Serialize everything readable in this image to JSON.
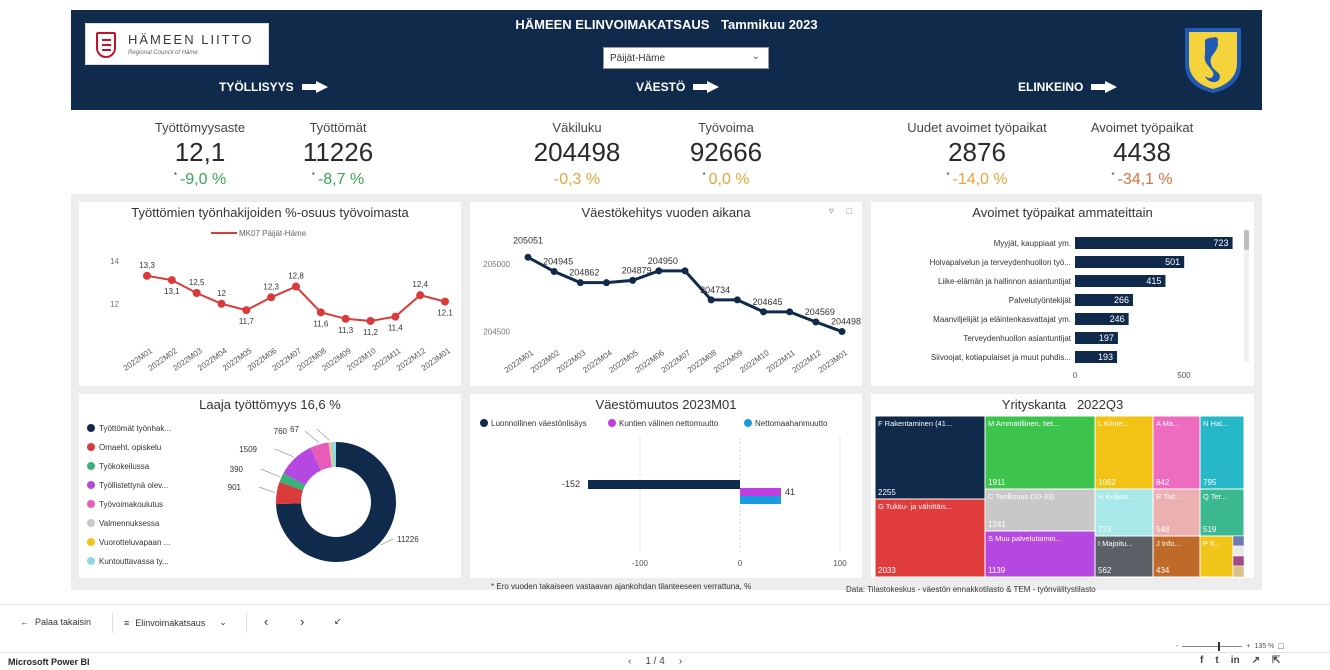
{
  "header": {
    "logo_title": "HÄMEEN LIITTO",
    "logo_sub": "Regional Council of Häme",
    "title": "HÄMEEN ELINVOIMAKATSAUS",
    "period": "Tammikuu 2023",
    "region_select": "Päijät-Häme",
    "nav": [
      "TYÖLLISYYS",
      "VÄESTÖ",
      "ELINKEINO"
    ]
  },
  "kpis": [
    {
      "label": "Työttömyysaste",
      "value": "12,1",
      "change": "-9,0 %",
      "color": "#3aa655"
    },
    {
      "label": "Työttömät",
      "value": "11226",
      "change": "-8,7 %",
      "color": "#3aa655"
    },
    {
      "label": "Väkiluku",
      "value": "204498",
      "change": "-0,3 %",
      "color": "#e8a33a"
    },
    {
      "label": "Työvoima",
      "value": "92666",
      "change": "0,0 %",
      "color": "#e8a33a"
    },
    {
      "label": "Uudet avoimet työpaikat",
      "value": "2876",
      "change": "-14,0 %",
      "color": "#e8a33a"
    },
    {
      "label": "Avoimet työpaikat",
      "value": "4438",
      "change": "-34,1 %",
      "color": "#e06d3a"
    }
  ],
  "chart_data": [
    {
      "type": "line",
      "title": "Työttömien työnhakijoiden %-osuus työvoimasta",
      "series": [
        {
          "name": "MK07 Päijät-Häme",
          "values": [
            13.3,
            13.1,
            12.5,
            12,
            11.7,
            12.3,
            12.8,
            11.6,
            11.3,
            11.2,
            11.4,
            12.4,
            12.1
          ]
        }
      ],
      "categories": [
        "2022M01",
        "2022M02",
        "2022M03",
        "2022M04",
        "2022M05",
        "2022M06",
        "2022M07",
        "2022M08",
        "2022M09",
        "2022M10",
        "2022M11",
        "2022M12",
        "2023M01"
      ],
      "data_labels": [
        "13,3",
        "13,1",
        "12,5",
        "12",
        "11,7",
        "12,3",
        "12,8",
        "11,6",
        "11,3",
        "11,2",
        "11,4",
        "12,4",
        "12,1"
      ],
      "y_ticks": [
        "14",
        "12"
      ],
      "ylim": [
        10.5,
        14.5
      ],
      "color": "#d93a3a"
    },
    {
      "type": "line",
      "title": "Väestökehitys vuoden aikana",
      "categories": [
        "2022M01",
        "2022M02",
        "2022M03",
        "2022M04",
        "2022M05",
        "2022M06",
        "2022M07",
        "2022M08",
        "2022M09",
        "2022M10",
        "2022M11",
        "2022M12",
        "2023M01"
      ],
      "values": [
        205051,
        204945,
        204862,
        204879,
        204950,
        204734,
        204645,
        204569,
        204498
      ],
      "plotted_values": [
        205051,
        204945,
        204862,
        204862,
        204879,
        204950,
        204950,
        204734,
        204734,
        204645,
        204645,
        204569,
        204498
      ],
      "data_labels": [
        "205051",
        "204945",
        "204862",
        "204879",
        "204950",
        "204734",
        "204645",
        "204569",
        "204498"
      ],
      "y_ticks": [
        "205000",
        "204500"
      ],
      "ylim": [
        204450,
        205150
      ],
      "color": "#102a4c"
    },
    {
      "type": "bar",
      "orientation": "horizontal",
      "title": "Avoimet työpaikat ammateittain",
      "categories": [
        "Myyjät, kauppiaat ym.",
        "Hoivapalvelun ja terveydenhuollon työ...",
        "Liike-elämän ja hallinnon asiantuntijat",
        "Palvelutyöntekijät",
        "Maanviljelijät ja eläintenkasvattajat ym.",
        "Terveydenhuollon asiantuntijat",
        "Siivoojat, kotiapulaiset ja muut puhdis..."
      ],
      "values": [
        723,
        501,
        415,
        266,
        246,
        197,
        193
      ],
      "x_ticks": [
        "0",
        "500"
      ],
      "xlim": [
        0,
        780
      ],
      "color": "#102a4c"
    },
    {
      "type": "pie",
      "title": "Laaja työttömyys",
      "subtitle": "16,6 %",
      "categories": [
        "Työttömät työnhak...",
        "Omaeht. opiskelu",
        "Työkokeilussa",
        "Työllistettynä olev...",
        "Työvoimakoulutus",
        "Valmennuksessa",
        "Vuorotteluvapaan ...",
        "Kuntouttavassa ty..."
      ],
      "values": [
        11226,
        901,
        390,
        1509,
        760,
        67,
        50,
        180
      ],
      "data_labels": [
        "11226",
        "901",
        "390",
        "1509",
        "760",
        "67",
        "",
        ""
      ],
      "colors": [
        "#102a4c",
        "#d93a3a",
        "#3ab07a",
        "#b548e0",
        "#e65cb8",
        "#c9c9c9",
        "#f0c419",
        "#8fd8e8"
      ]
    },
    {
      "type": "bar",
      "orientation": "horizontal",
      "title": "Väestömuutos 2023M01",
      "series": [
        {
          "name": "Luonnollinen väestönlisäys",
          "values": [
            -152
          ],
          "color": "#102a4c"
        },
        {
          "name": "Kuntien välinen nettomuutto",
          "values": [
            41
          ],
          "color": "#c03ee0"
        },
        {
          "name": "Nettomaahanmuutto",
          "values": [
            41
          ],
          "color": "#1a9be0"
        }
      ],
      "data_labels": [
        "-152",
        "41"
      ],
      "x_ticks": [
        "-100",
        "0",
        "100"
      ],
      "xlim": [
        -210,
        110
      ]
    },
    {
      "type": "heatmap",
      "subtype": "treemap",
      "title": "Yrityskanta",
      "period": "2022Q3",
      "cells": [
        {
          "label": "F Rakentaminen (41...",
          "value": "2255",
          "color": "#102a4c"
        },
        {
          "label": "G Tukku- ja vähittäis...",
          "value": "2033",
          "color": "#e03c3c"
        },
        {
          "label": "M Ammatillinen, tiet...",
          "value": "1911",
          "color": "#3cc44c"
        },
        {
          "label": "C Teollisuus (10-33)",
          "value": "1241",
          "color": "#c8c8c8"
        },
        {
          "label": "S Muu palvelutoimin...",
          "value": "1139",
          "color": "#b548e0"
        },
        {
          "label": "L Kiinte...",
          "value": "1062",
          "color": "#f2c314"
        },
        {
          "label": "H Kuljetu...",
          "value": "723",
          "color": "#a8e8e8"
        },
        {
          "label": "I Majoitu...",
          "value": "562",
          "color": "#5a6066"
        },
        {
          "label": "A Ma...",
          "value": "842",
          "color": "#ee6cc0"
        },
        {
          "label": "R Tait...",
          "value": "548",
          "color": "#ecb0b0"
        },
        {
          "label": "J Info...",
          "value": "434",
          "color": "#c06a2a"
        },
        {
          "label": "N Hal...",
          "value": "795",
          "color": "#26b8c8"
        },
        {
          "label": "Q Ter...",
          "value": "519",
          "color": "#3cb890"
        },
        {
          "label": "P K...",
          "value": "",
          "color": "#f0c419"
        }
      ]
    }
  ],
  "pie_legend_title": "Laaja työttömyys",
  "footer": {
    "note": "Ero vuoden takaiseen vastaavan ajankohdan tilanteeseen verrattuna, %",
    "note_marker": "*",
    "data_source": "Data: Tilastokeskus - väestön ennakkotilasto & TEM - työnvälitystilasto"
  },
  "navbar": {
    "back_label": "Palaa takaisin",
    "pages_label": "Elinvoimakatsaus",
    "zoom_label": "135 %"
  },
  "status": {
    "brand": "Microsoft Power BI",
    "pager": "1 / 4"
  }
}
